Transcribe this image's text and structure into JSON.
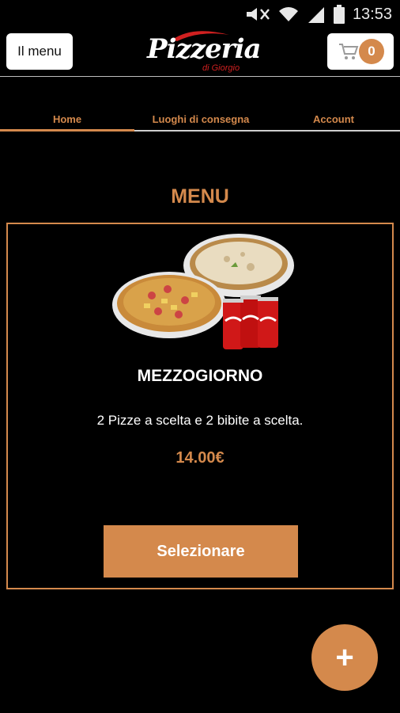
{
  "status_bar": {
    "time": "13:53"
  },
  "header": {
    "menu_label": "Il menu",
    "logo_title": "Pizzeria",
    "logo_subtitle": "di Giorgio",
    "cart_count": "0"
  },
  "tabs": [
    {
      "label": "Home",
      "active": true
    },
    {
      "label": "Luoghi di consegna",
      "active": false
    },
    {
      "label": "Account",
      "active": false
    }
  ],
  "main": {
    "section_title": "MENU",
    "product": {
      "name": "MEZZOGIORNO",
      "description": "2 Pizze a scelta e 2 bibite a scelta.",
      "price": "14.00€",
      "select_label": "Selezionare"
    }
  },
  "fab": {
    "label": "+"
  },
  "colors": {
    "accent": "#d4894c",
    "background": "#000000"
  }
}
